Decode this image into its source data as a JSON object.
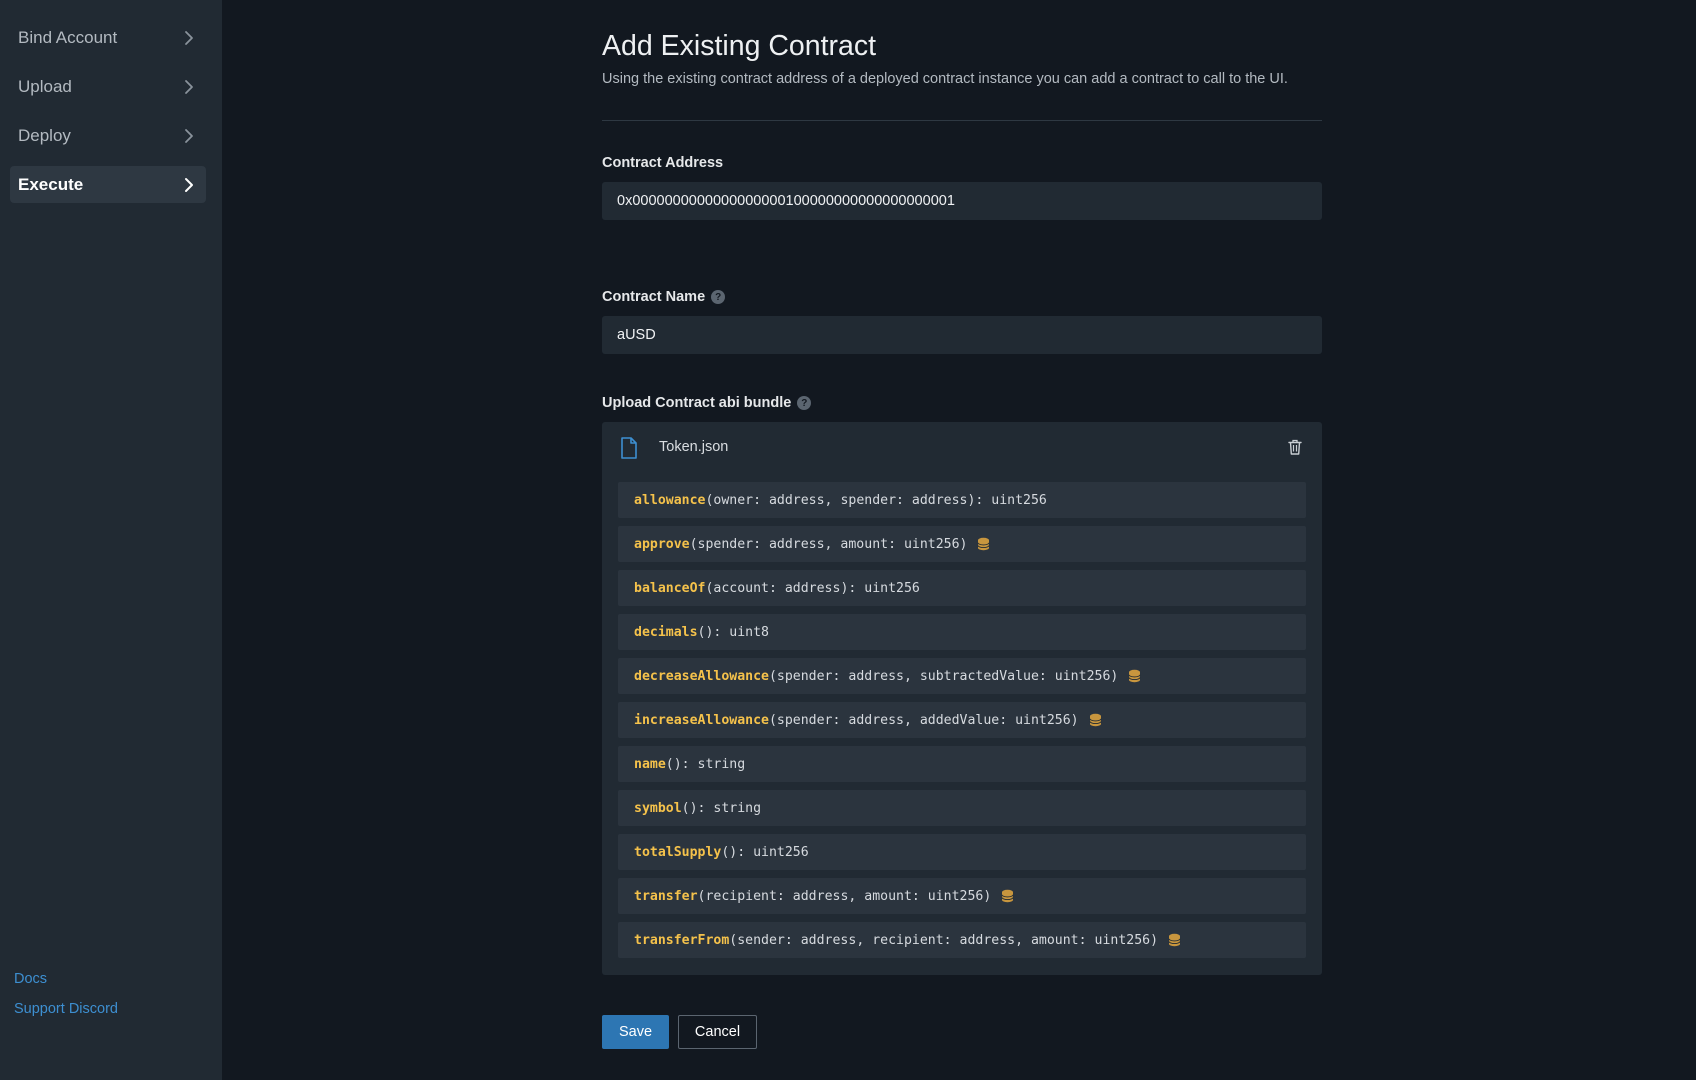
{
  "sidebar": {
    "items": [
      {
        "label": "Bind Account",
        "active": false
      },
      {
        "label": "Upload",
        "active": false
      },
      {
        "label": "Deploy",
        "active": false
      },
      {
        "label": "Execute",
        "active": true
      }
    ],
    "links": {
      "docs": "Docs",
      "support": "Support Discord"
    }
  },
  "page": {
    "title": "Add Existing Contract",
    "subtitle": "Using the existing contract address of a deployed contract instance you can add a contract to call to the UI."
  },
  "form": {
    "address_label": "Contract Address",
    "address_value": "0x0000000000000000000100000000000000000001",
    "name_label": "Contract Name",
    "name_value": "aUSD",
    "abi_label": "Upload Contract abi bundle"
  },
  "abi": {
    "file_name": "Token.json",
    "functions": [
      {
        "name": "allowance",
        "signature": "(owner: address, spender: address): uint256",
        "mutates": false
      },
      {
        "name": "approve",
        "signature": "(spender: address, amount: uint256)",
        "mutates": true
      },
      {
        "name": "balanceOf",
        "signature": "(account: address): uint256",
        "mutates": false
      },
      {
        "name": "decimals",
        "signature": "(): uint8",
        "mutates": false
      },
      {
        "name": "decreaseAllowance",
        "signature": "(spender: address, subtractedValue: uint256)",
        "mutates": true
      },
      {
        "name": "increaseAllowance",
        "signature": "(spender: address, addedValue: uint256)",
        "mutates": true
      },
      {
        "name": "name",
        "signature": "(): string",
        "mutates": false
      },
      {
        "name": "symbol",
        "signature": "(): string",
        "mutates": false
      },
      {
        "name": "totalSupply",
        "signature": "(): uint256",
        "mutates": false
      },
      {
        "name": "transfer",
        "signature": "(recipient: address, amount: uint256)",
        "mutates": true
      },
      {
        "name": "transferFrom",
        "signature": "(sender: address, recipient: address, amount: uint256)",
        "mutates": true
      }
    ]
  },
  "actions": {
    "save": "Save",
    "cancel": "Cancel"
  },
  "colors": {
    "background": "#121820",
    "sidebar": "#212a33",
    "accent": "#2d76b3",
    "function_name": "#f5c24b",
    "link": "#3d8fd1",
    "coin": "#c8963e"
  }
}
